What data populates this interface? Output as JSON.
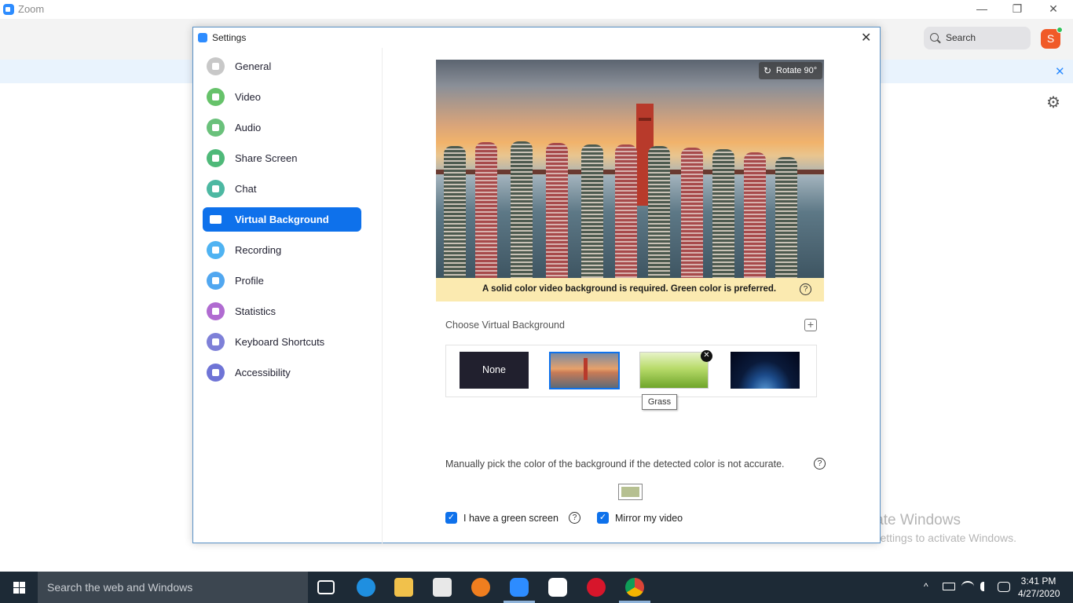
{
  "window": {
    "title": "Zoom",
    "minimize": "—",
    "restore": "❐",
    "close": "✕"
  },
  "topbar": {
    "search_label": "Search",
    "avatar_letter": "S"
  },
  "banner": {
    "close": "✕"
  },
  "main_gear": "⚙",
  "watermark": {
    "title": "Activate Windows",
    "subtitle": "Go to Settings to activate Windows."
  },
  "settings": {
    "title": "Settings",
    "close": "✕",
    "nav": [
      {
        "label": "General",
        "color": "#c8c8c8"
      },
      {
        "label": "Video",
        "color": "#66c26a"
      },
      {
        "label": "Audio",
        "color": "#6ac17b"
      },
      {
        "label": "Share Screen",
        "color": "#4fb979"
      },
      {
        "label": "Chat",
        "color": "#4db8a2"
      },
      {
        "label": "Virtual Background",
        "color": "#0e71eb"
      },
      {
        "label": "Recording",
        "color": "#4fb3f2"
      },
      {
        "label": "Profile",
        "color": "#51a7f0"
      },
      {
        "label": "Statistics",
        "color": "#b06bd1"
      },
      {
        "label": "Keyboard Shortcuts",
        "color": "#7e80d8"
      },
      {
        "label": "Accessibility",
        "color": "#6f74d6"
      }
    ],
    "preview": {
      "rotate_label": "Rotate 90°",
      "rotate_icon": "↻"
    },
    "warning": {
      "text": "A solid color video background is required. Green color is preferred.",
      "help": "?"
    },
    "choose_label": "Choose Virtual Background",
    "add_icon": "+",
    "backgrounds": {
      "none_label": "None",
      "remove_icon": "✕",
      "tooltip": "Grass"
    },
    "manual": {
      "text": "Manually pick the color of the background if the detected color is not accurate.",
      "help": "?",
      "swatch_color": "#b6c091"
    },
    "green_screen": {
      "label": "I have a green screen",
      "checked": true,
      "help": "?"
    },
    "mirror": {
      "label": "Mirror my video",
      "checked": true
    },
    "checkmark": "✓"
  },
  "taskbar": {
    "search_placeholder": "Search the web and Windows",
    "time": "3:41 PM",
    "date": "4/27/2020",
    "tray_chevron": "^"
  }
}
